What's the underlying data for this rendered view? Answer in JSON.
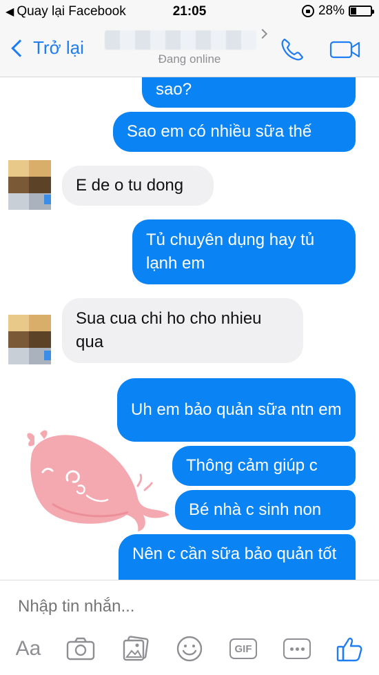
{
  "status_bar": {
    "back_app": "Quay lại Facebook",
    "time": "21:05",
    "battery": "28%",
    "battery_level": 0.28
  },
  "header": {
    "back_label": "Trở lại",
    "status": "Đang online"
  },
  "messages": [
    {
      "side": "out",
      "text": "sao?"
    },
    {
      "side": "out",
      "text": "Sao em có nhiều sữa thế"
    },
    {
      "side": "in",
      "text": "E de o tu dong"
    },
    {
      "side": "out",
      "text": "Tủ chuyên dụng hay tủ lạnh em"
    },
    {
      "side": "in",
      "text": "Sua cua chi ho cho nhieu qua"
    },
    {
      "side": "out",
      "text": "Uh em bảo quản sữa ntn em"
    },
    {
      "side": "out",
      "text": "Thông cảm giúp c"
    },
    {
      "side": "out",
      "text": "Bé nhà c sinh non"
    },
    {
      "side": "out",
      "text": "Nên c cần sữa bảo quản tốt"
    }
  ],
  "composer": {
    "placeholder": "Nhập tin nhắn...",
    "aa_label": "Aa",
    "gif_label": "GIF"
  },
  "colors": {
    "accent": "#0a84f5",
    "incoming_bubble": "#f0f0f2",
    "whale": "#f4a8b0"
  },
  "icons": [
    "back-chevron-icon",
    "phone-icon",
    "video-camera-icon",
    "camera-icon",
    "photo-gallery-icon",
    "smiley-icon",
    "more-icon",
    "like-thumb-icon"
  ]
}
